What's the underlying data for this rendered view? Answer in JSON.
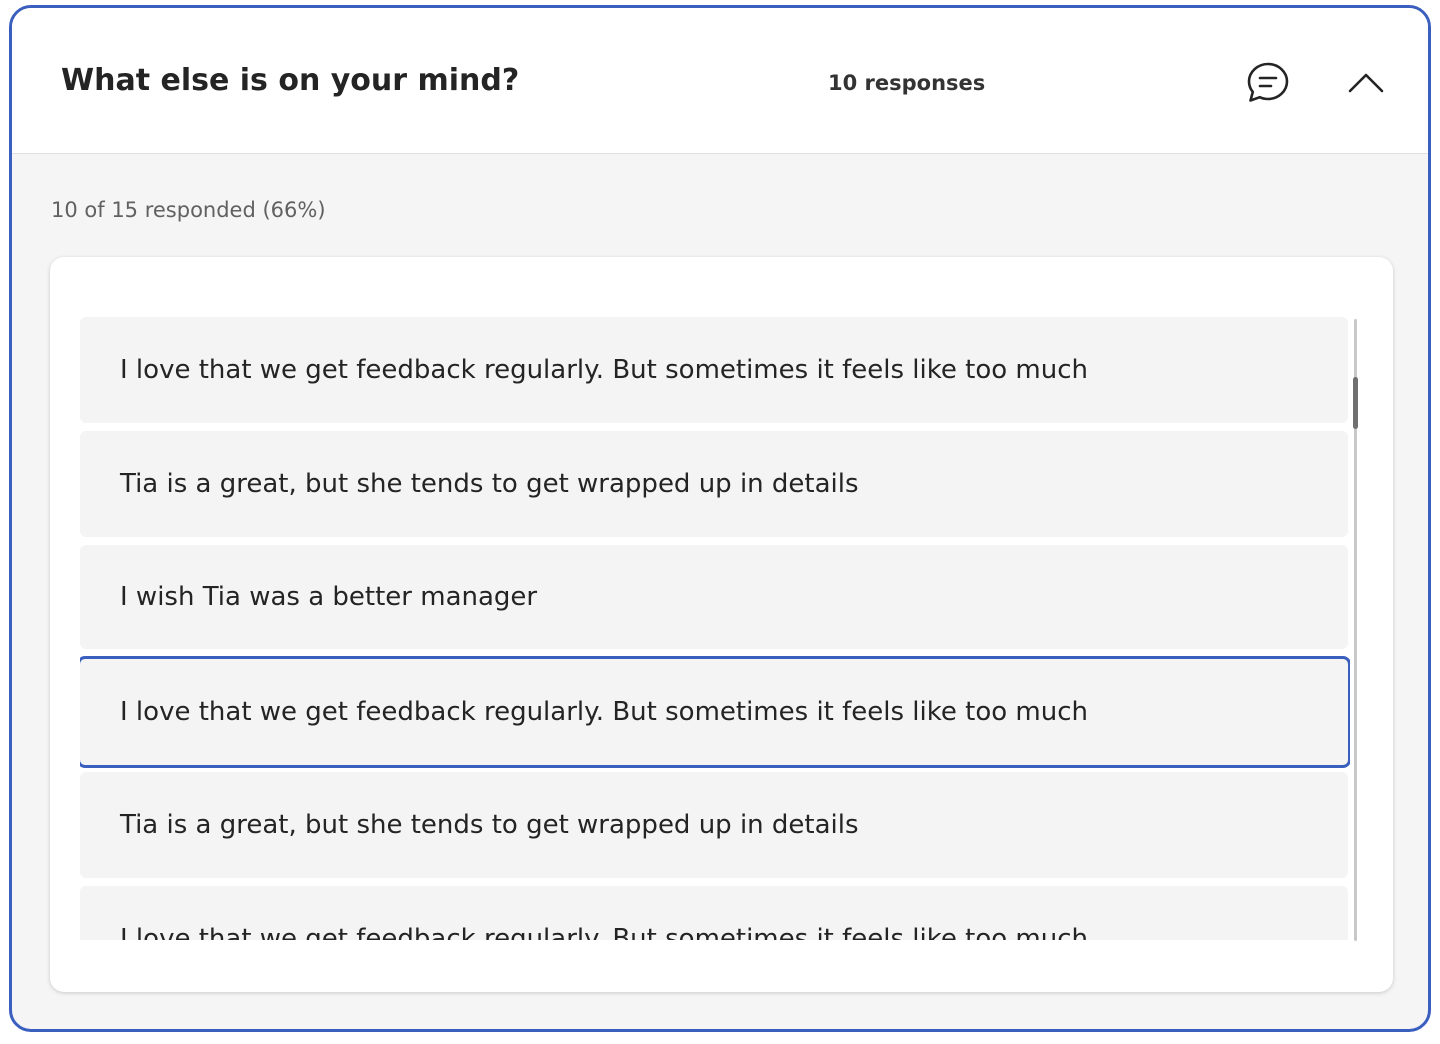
{
  "card": {
    "question": "What else is on your mind?",
    "responses_label": "10 responses",
    "comment_icon": "comment-icon",
    "collapse_icon": "chevron-up-icon",
    "summary": "10 of 15 responded (66%)"
  },
  "responses": [
    {
      "text": "I love that we get feedback regularly. But sometimes it feels like too much"
    },
    {
      "text": "Tia is a great, but she tends to get wrapped up in details"
    },
    {
      "text": "I wish Tia was a better manager"
    },
    {
      "text": "I love that we get feedback regularly. But sometimes it feels like too much",
      "selected": true
    },
    {
      "text": "Tia is a great, but she tends to get wrapped up in details"
    },
    {
      "text": "I love that we get feedback regularly. But sometimes it feels like too much"
    }
  ],
  "colors": {
    "accent": "#3a5fbf",
    "item_bg": "#f4f4f4",
    "panel_bg": "#f5f5f5"
  }
}
